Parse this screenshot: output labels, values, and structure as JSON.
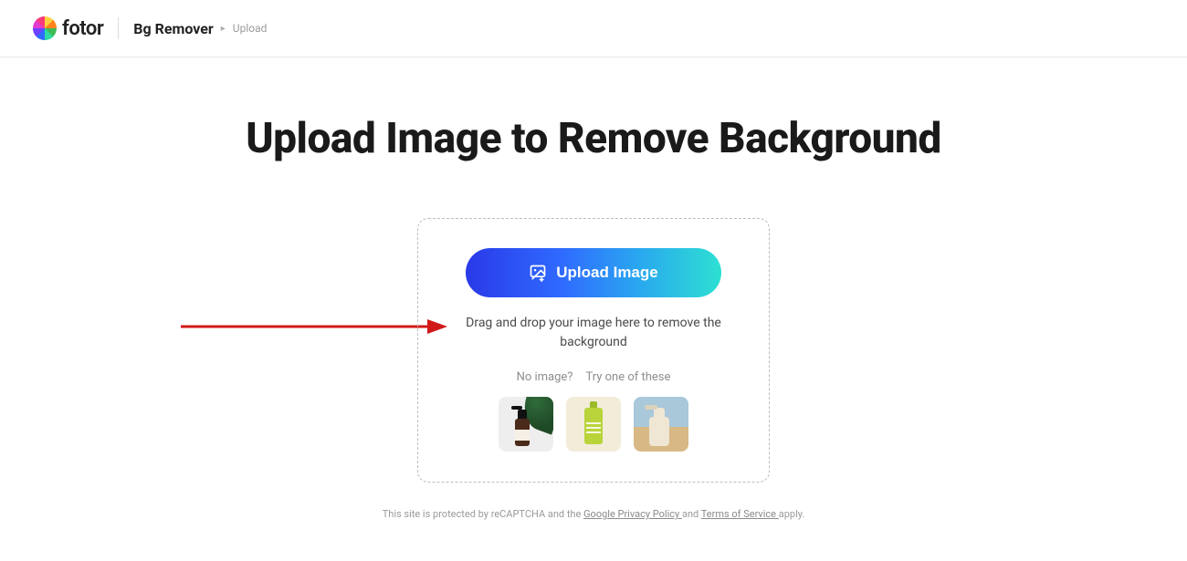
{
  "header": {
    "brand": "fotor",
    "crumb_main": "Bg Remover",
    "crumb_sub": "Upload"
  },
  "main": {
    "title": "Upload Image to Remove Background",
    "upload_button": "Upload Image",
    "drop_text": "Drag and drop your image here to remove the background",
    "no_image_label": "No image?",
    "try_label": "Try one of these",
    "samples": [
      "sample-bottle-leaf",
      "sample-green-tube",
      "sample-beige-dispenser"
    ]
  },
  "footer": {
    "prefix": "This site is protected by reCAPTCHA and the ",
    "privacy_link": "Google Privacy Policy ",
    "mid": " and ",
    "terms_link": "Terms of Service ",
    "suffix": " apply."
  }
}
